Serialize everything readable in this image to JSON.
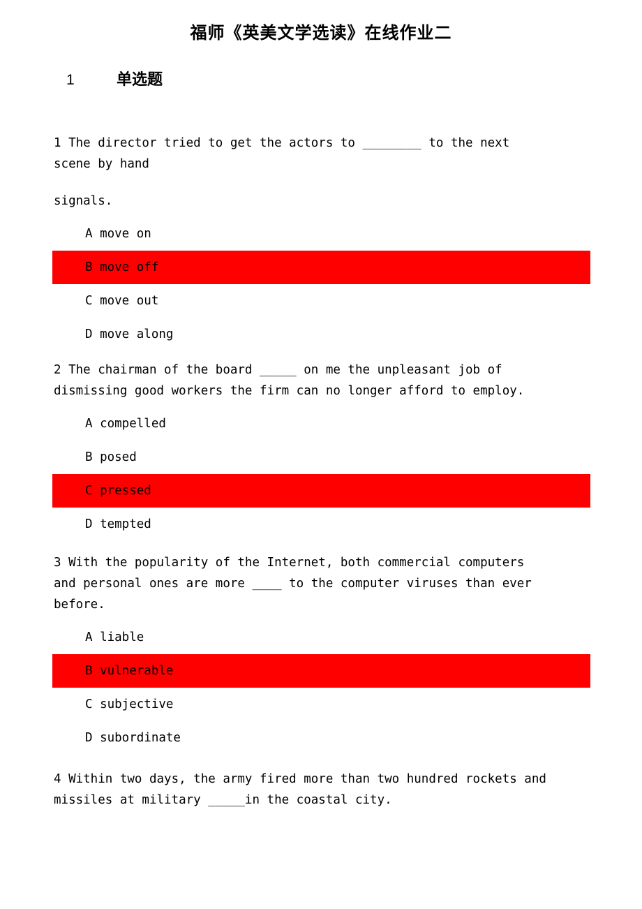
{
  "document": {
    "title": "福师《英美文学选读》在线作业二",
    "section": {
      "number": "1",
      "label": "单选题"
    },
    "highlight_color": "#ff0000",
    "text_color": "#000000",
    "background_color": "#ffffff"
  },
  "questions": [
    {
      "number": "1",
      "stem_line1": "1 The director tried to get the actors to ________ to the next",
      "stem_line2": "scene by hand",
      "stem_continuation": "signals.",
      "options": [
        {
          "letter": "A",
          "text": "A move on",
          "highlighted": false
        },
        {
          "letter": "B",
          "text": "B move off",
          "highlighted": true
        },
        {
          "letter": "C",
          "text": "C move out",
          "highlighted": false
        },
        {
          "letter": "D",
          "text": "D move along",
          "highlighted": false
        }
      ]
    },
    {
      "number": "2",
      "stem_line1": "2 The chairman of the board _____    on me the unpleasant job of",
      "stem_line2": "dismissing good workers the firm can no longer afford to employ.",
      "options": [
        {
          "letter": "A",
          "text": "A compelled",
          "highlighted": false
        },
        {
          "letter": "B",
          "text": "B posed",
          "highlighted": false
        },
        {
          "letter": "C",
          "text": "C pressed",
          "highlighted": true
        },
        {
          "letter": "D",
          "text": "D tempted",
          "highlighted": false
        }
      ]
    },
    {
      "number": "3",
      "stem_line1": "3 With the popularity of the Internet, both commercial computers",
      "stem_line2": "and personal ones are more ____ to the computer viruses than ever",
      "stem_line3": "before.",
      "options": [
        {
          "letter": "A",
          "text": "A liable",
          "highlighted": false
        },
        {
          "letter": "B",
          "text": "B vulnerable",
          "highlighted": true
        },
        {
          "letter": "C",
          "text": "C subjective",
          "highlighted": false
        },
        {
          "letter": "D",
          "text": "D subordinate",
          "highlighted": false
        }
      ]
    },
    {
      "number": "4",
      "stem_line1": "4 Within two days, the army fired more than two hundred rockets and",
      "stem_line2": "missiles at military _____in the coastal city.",
      "options": []
    }
  ]
}
